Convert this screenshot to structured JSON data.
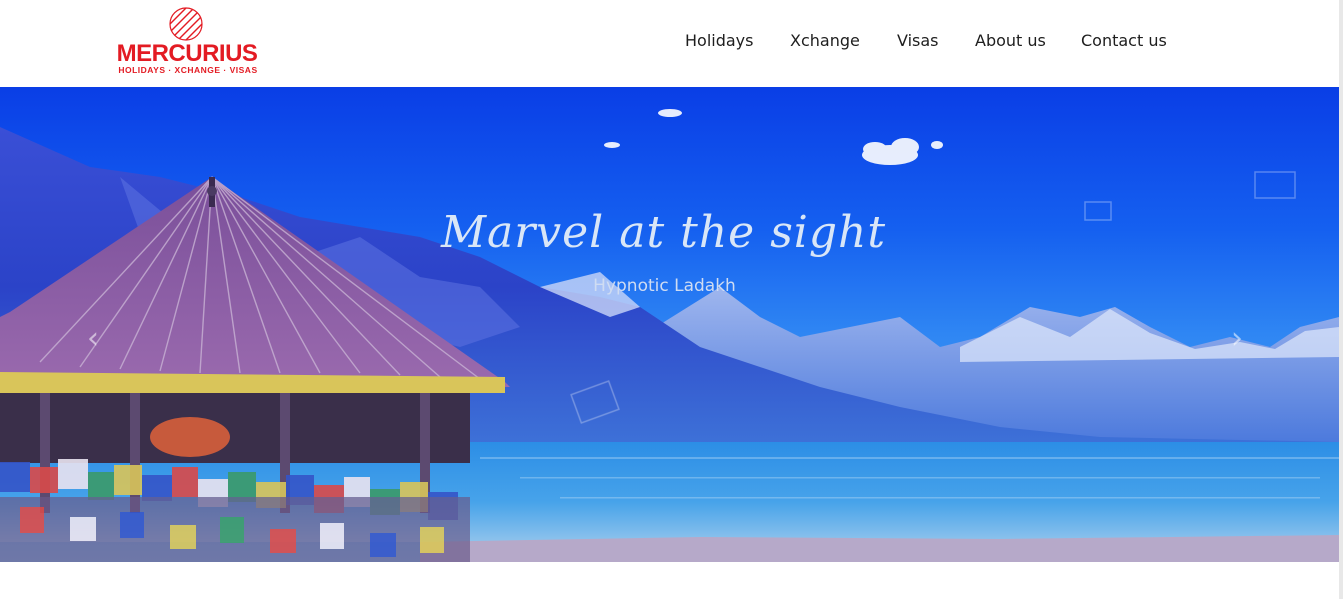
{
  "brand": {
    "name": "MERCURIUS",
    "tagline": "HOLIDAYS · XCHANGE · VISAS",
    "color": "#e31b23"
  },
  "nav": {
    "items": [
      {
        "label": "Holidays"
      },
      {
        "label": "Xchange"
      },
      {
        "label": "Visas"
      },
      {
        "label": "About us"
      },
      {
        "label": "Contact us"
      }
    ]
  },
  "hero": {
    "title": "Marvel at the sight",
    "subtitle": "Hypnotic Ladakh",
    "prev_icon": "chevron-left-icon",
    "next_icon": "chevron-right-icon"
  }
}
